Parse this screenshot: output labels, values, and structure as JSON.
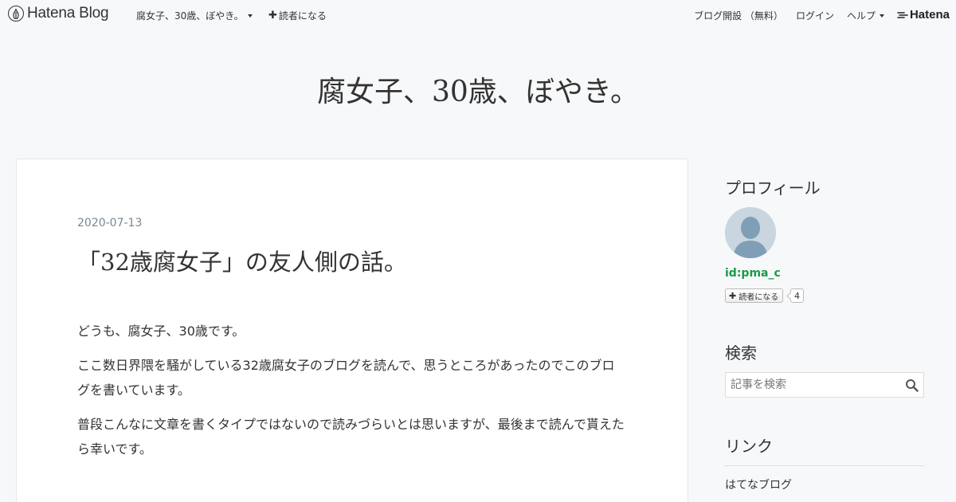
{
  "topbar": {
    "brand": "Hatena Blog",
    "blog_menu": "腐女子、30歳、ぼやき。",
    "subscribe": "読者になる",
    "right_items": [
      "ブログ開設 （無料）",
      "ログイン",
      "ヘルプ"
    ],
    "hatena": "Hatena"
  },
  "blog": {
    "title": "腐女子、30歳、ぼやき。"
  },
  "entry": {
    "date": "2020-07-13",
    "title": "「32歳腐女子」の友人側の話。",
    "paragraphs": [
      "どうも、腐女子、30歳です。",
      "ここ数日界隈を騒がしている32歳腐女子のブログを読んで、思うところがあったのでこのブログを書いています。",
      "普段こんなに文章を書くタイプではないので読みづらいとは思いますが、最後まで読んで貰えたら幸いです。"
    ]
  },
  "sidebar": {
    "profile_heading": "プロフィール",
    "user_id": "id:pma_c",
    "subscribe_label": "読者になる",
    "subscriber_count": "4",
    "search_heading": "検索",
    "search_placeholder": "記事を検索",
    "links_heading": "リンク",
    "links": [
      "はてなブログ"
    ]
  },
  "colors": {
    "background": "#f7f8f9",
    "id_link": "#1a9a4a",
    "date": "#7a868f"
  },
  "icons": [
    "hatena-logo-icon",
    "chevron-down-icon",
    "plus-icon",
    "avatar-placeholder-icon",
    "search-icon"
  ]
}
